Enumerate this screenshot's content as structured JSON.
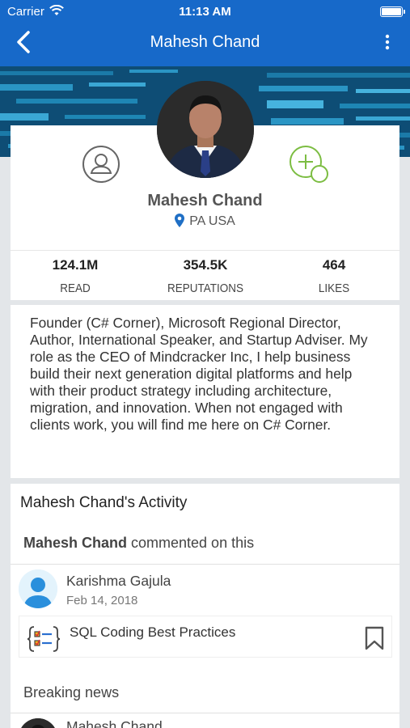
{
  "status_bar": {
    "carrier": "Carrier",
    "time": "11:13 AM"
  },
  "nav": {
    "title": "Mahesh Chand",
    "back_icon": "chevron-left-icon",
    "more_icon": "more-vertical-icon"
  },
  "profile": {
    "name": "Mahesh Chand",
    "location": "PA USA",
    "stats": [
      {
        "value": "124.1M",
        "label": "READ"
      },
      {
        "value": "354.5K",
        "label": "REPUTATIONS"
      },
      {
        "value": "464",
        "label": "LIKES"
      }
    ]
  },
  "bio": "Founder (C# Corner), Microsoft Regional Director, Author, International Speaker, and Startup Adviser. My role as the CEO of Mindcracker Inc, I help business build their next generation digital platforms and help with their product strategy including architecture, migration, and innovation. When not engaged with clients work, you will find me here on C# Corner.",
  "activity": {
    "title": "Mahesh Chand's Activity",
    "actor": "Mahesh Chand",
    "action": " commented on this",
    "item": {
      "author": "Karishma Gajula",
      "date": "Feb 14, 2018",
      "post_title": "SQL Coding Best Practices"
    },
    "section_label": "Breaking news",
    "next_author": "Mahesh Chand"
  },
  "colors": {
    "nav_bg": "#1769c9",
    "accent_green": "#7cbd42",
    "pin_blue": "#1f6fc5"
  }
}
